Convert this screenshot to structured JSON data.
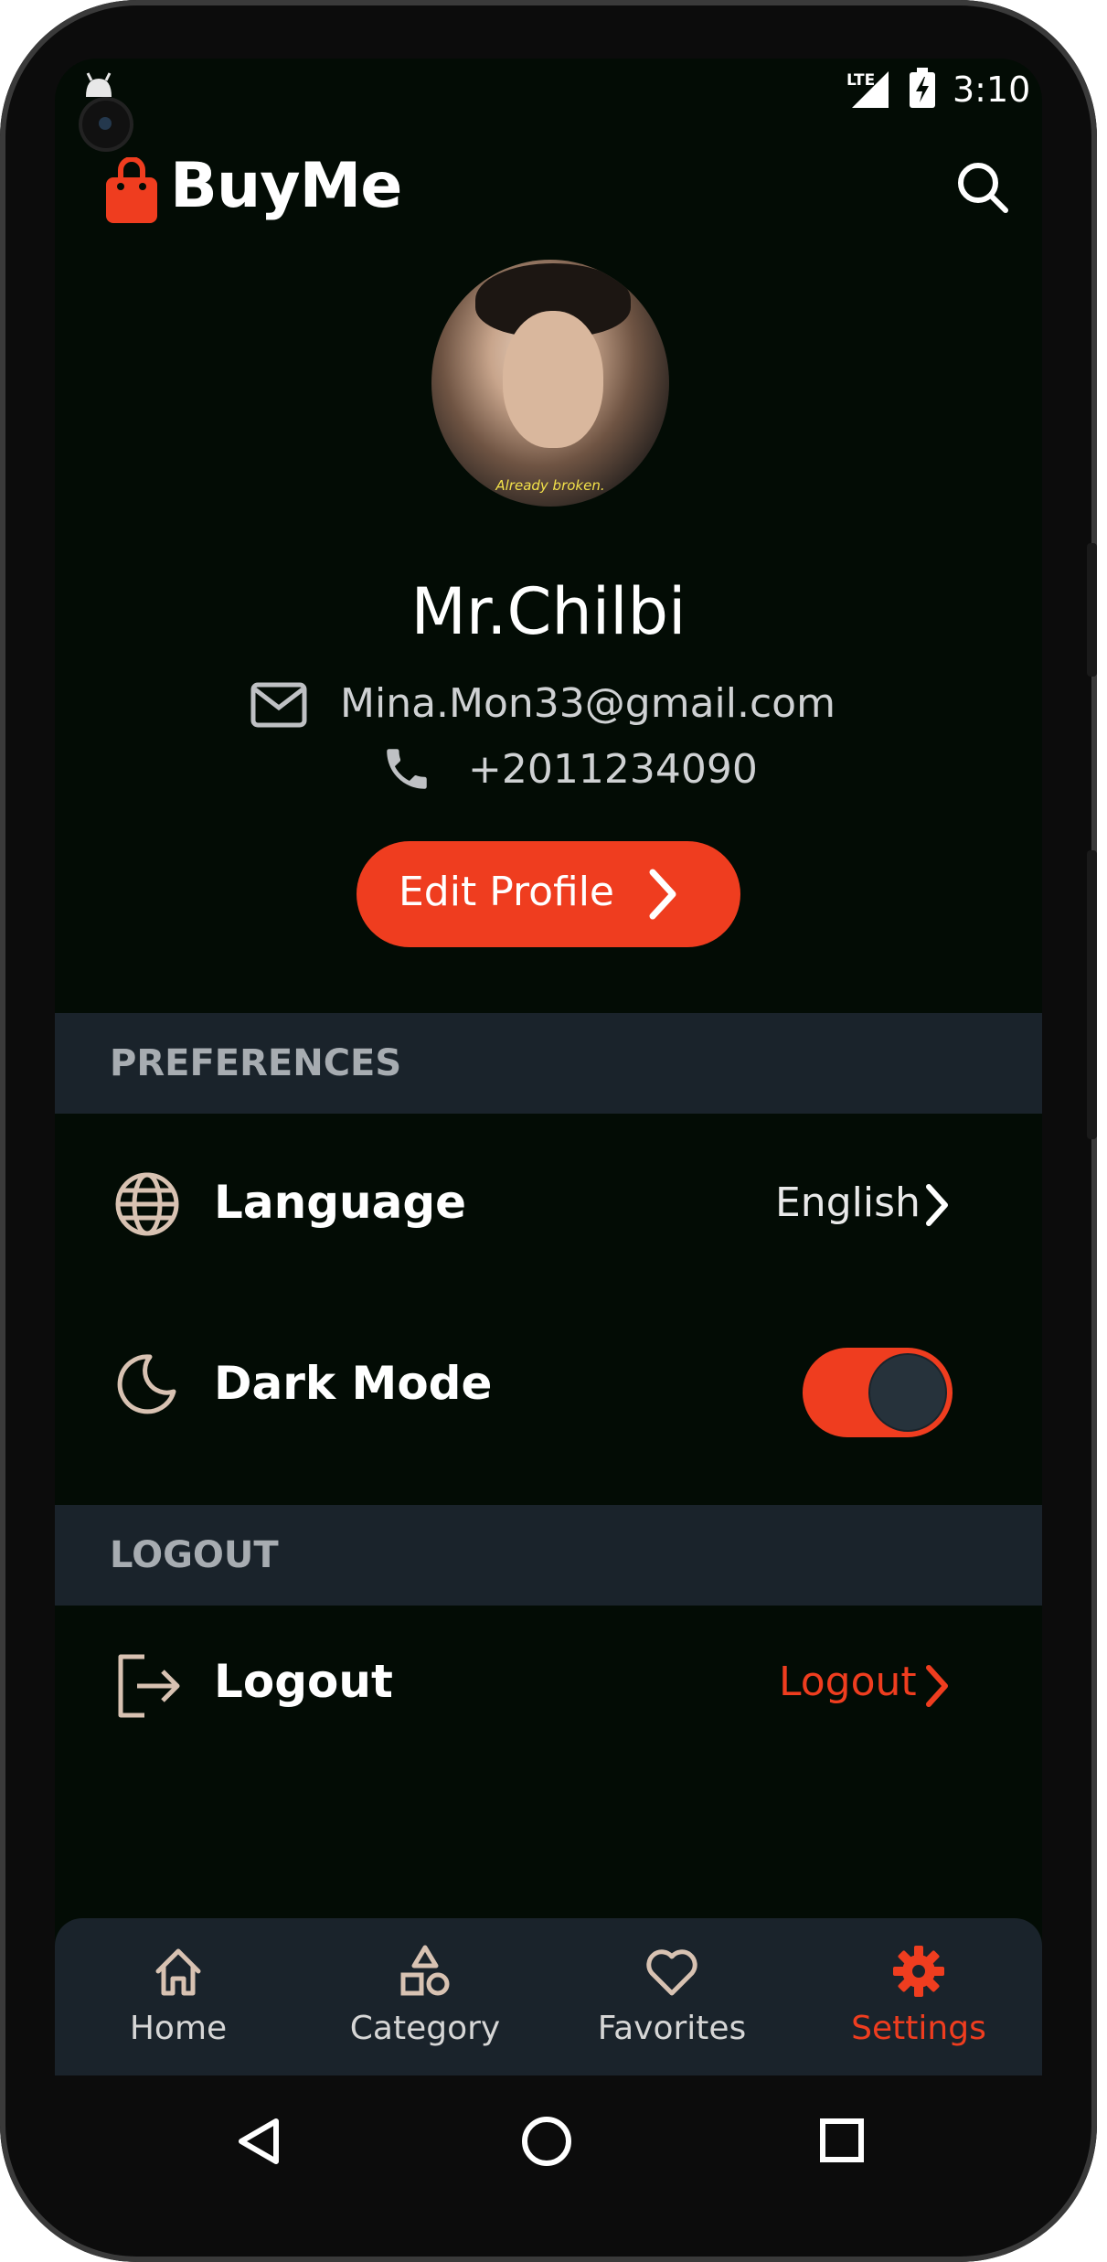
{
  "status_bar": {
    "time": "3:10",
    "network": "LTE"
  },
  "app_bar": {
    "brand": "BuyMe",
    "icons": [
      "shopping-bag-icon",
      "search-icon"
    ]
  },
  "profile": {
    "image_caption": "Already broken.",
    "name": "Mr.Chilbi",
    "email": "Mina.Mon33@gmail.com",
    "phone": "+2011234090",
    "edit_label": "Edit Profile"
  },
  "sections": {
    "preferences_header": "PREFERENCES",
    "language_label": "Language",
    "language_value": "English",
    "dark_mode_label": "Dark Mode",
    "dark_mode_on": true,
    "logout_header": "LOGOUT",
    "logout_label": "Logout",
    "logout_action": "Logout"
  },
  "bottom_nav": {
    "items": [
      {
        "label": "Home",
        "icon": "home-icon",
        "active": false
      },
      {
        "label": "Category",
        "icon": "category-icon",
        "active": false
      },
      {
        "label": "Favorites",
        "icon": "heart-icon",
        "active": false
      },
      {
        "label": "Settings",
        "icon": "gear-icon",
        "active": true
      }
    ]
  },
  "colors": {
    "accent": "#ef3d1f",
    "background": "#030c05",
    "section_header": "#1a232b",
    "icon_tint": "#d8c2b2"
  }
}
